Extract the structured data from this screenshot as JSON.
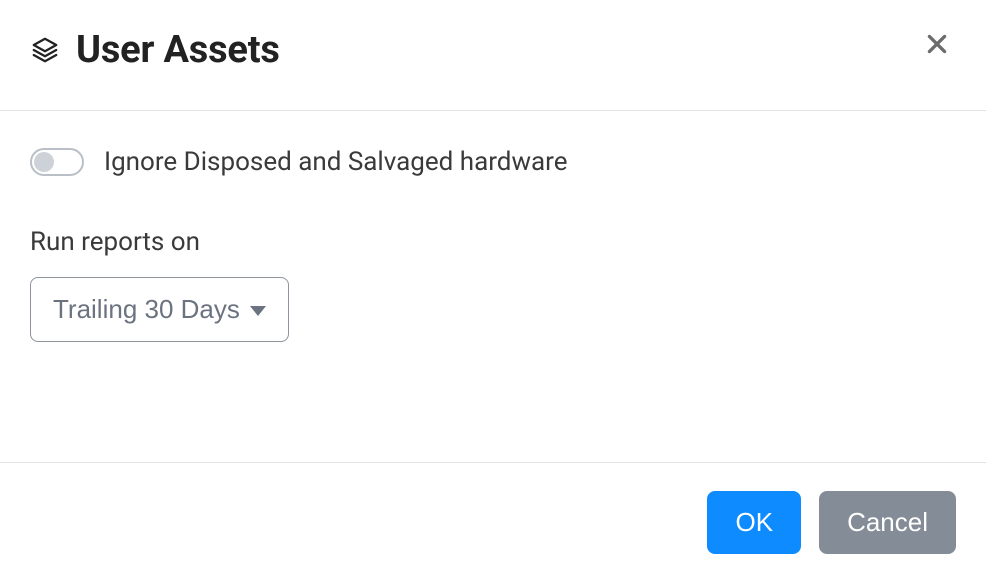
{
  "header": {
    "title": "User Assets"
  },
  "body": {
    "ignore_toggle_label": "Ignore Disposed and Salvaged hardware",
    "ignore_toggle_state": false,
    "run_reports_label": "Run reports on",
    "date_range_selected": "Trailing 30 Days"
  },
  "footer": {
    "ok_label": "OK",
    "cancel_label": "Cancel"
  },
  "colors": {
    "primary": "#0d8bff",
    "secondary": "#848d97",
    "border": "#e2e2e2",
    "text": "#222222"
  }
}
